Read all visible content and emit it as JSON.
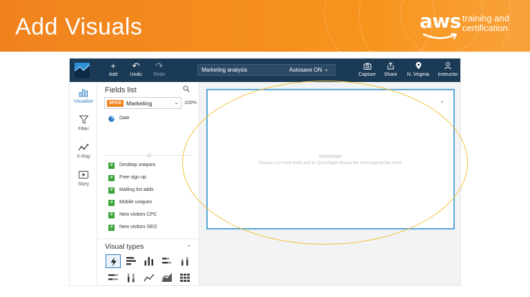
{
  "slide": {
    "title": "Add Visuals",
    "brand_word": "aws",
    "brand_tagline_1": "training and",
    "brand_tagline_2": "certification"
  },
  "toolbar": {
    "add_label": "Add",
    "undo_label": "Undo",
    "redo_label": "Redo",
    "analysis_name": "Marketing analysis",
    "autosave_label": "Autosave ON",
    "capture_label": "Capture",
    "share_label": "Share",
    "region_label": "N. Virginia",
    "user_label": "Instructor"
  },
  "rail": {
    "items": [
      {
        "label": "Visualize",
        "icon": "bar-chart-icon",
        "active": true
      },
      {
        "label": "Filter",
        "icon": "filter-icon"
      },
      {
        "label": "X-Ray",
        "icon": "xray-icon"
      },
      {
        "label": "Story",
        "icon": "story-icon"
      }
    ]
  },
  "fields_panel": {
    "title": "Fields list",
    "dataset_badge": "SPICE",
    "dataset_name": "Marketing",
    "spice_percent": "100%",
    "dimensions": [
      "Date"
    ],
    "measures": [
      "Desktop uniques",
      "Free sign up",
      "Mailing list adds",
      "Mobile uniques",
      "New visitors CPC",
      "New visitors SEO"
    ],
    "measure_glyph": "#"
  },
  "visual_types": {
    "title": "Visual types",
    "icons": [
      "autograph-icon",
      "horizontal-bar-icon",
      "vertical-bar-icon",
      "stacked-horizontal-bar-icon",
      "stacked-vertical-bar-icon",
      "percent-horizontal-bar-icon",
      "percent-vertical-bar-icon",
      "line-chart-icon",
      "area-line-chart-icon",
      "pivot-table-icon",
      "scatter-plot-icon",
      "tree-map-icon",
      "pie-chart-icon",
      "heat-map-icon",
      "kpi-icon"
    ],
    "selected_index": 0
  },
  "visual": {
    "title": "AutoGraph",
    "subtitle": "Choose 1 or more fields and let QuickSight choose the most appropriate chart."
  },
  "colors": {
    "header_orange": "#f0821e",
    "toolbar_navy": "#1b3a55",
    "accent_blue": "#2a79bf",
    "visual_border": "#57a7d9",
    "highlight_ellipse": "#f3c13a",
    "measure_green": "#3aa43a",
    "spice_orange": "#f0821e"
  }
}
